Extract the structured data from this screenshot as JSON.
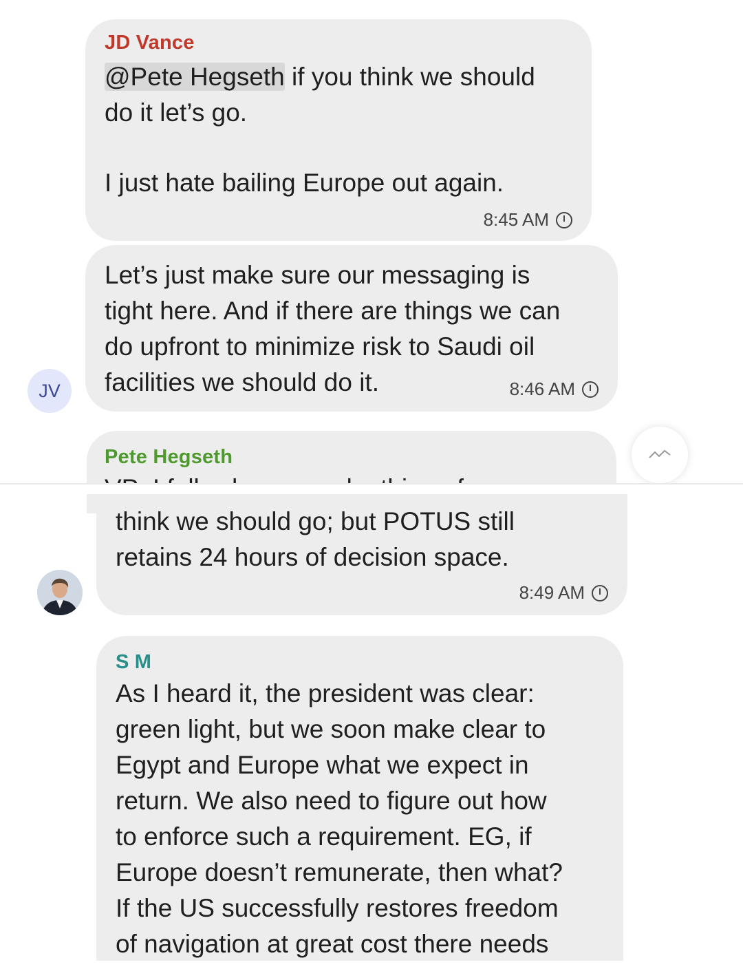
{
  "messages": [
    {
      "sender": "JD Vance",
      "sender_color": "#c0392b",
      "mention": "@Pete Hegseth",
      "line1_rest": " if you think we should",
      "line2": "do it let’s go.",
      "line3": "I just hate bailing Europe out again.",
      "time": "8:45 AM"
    },
    {
      "lines": [
        "Let’s just make sure our messaging is",
        "tight here. And if there are things we can",
        "do upfront to minimize risk to Saudi oil",
        "facilities we should do it."
      ],
      "time": "8:46 AM",
      "avatar_initials": "JV"
    },
    {
      "sender": "Pete Hegseth",
      "sender_color": "#4f9a2f",
      "cut_line": "VP: I fully share your loathing of",
      "lines": [
        "think we should go; but POTUS still",
        "retains 24 hours of decision space."
      ],
      "time": "8:49 AM"
    },
    {
      "sender": "S M",
      "sender_color": "#2a8f8a",
      "lines": [
        "As I heard it, the president was clear:",
        "green light, but we soon make clear to",
        "Egypt and Europe what we expect in",
        "return. We also need to figure out how",
        "to enforce such a requirement. EG, if",
        "Europe doesn’t remunerate, then what?",
        "If the US successfully restores freedom",
        "of navigation at great cost there needs"
      ]
    }
  ]
}
